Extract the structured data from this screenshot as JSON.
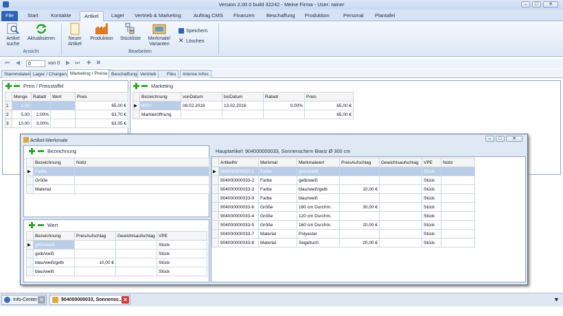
{
  "window": {
    "title": "Version 2.00.0  build 32242 - Meine Firma - User: rainer"
  },
  "ribbon_tabs": [
    "File",
    "Start",
    "Kontakte",
    "Artikel",
    "Lager",
    "Vertrieb & Marketing",
    "Auftrag CMS",
    "Finanzen",
    "Beschaffung",
    "Produktion",
    "Personal",
    "Plantafel"
  ],
  "ribbon": {
    "artikel_suche": "Artikel suche",
    "aktualisieren": "Aktualisieren",
    "neuer_artikel": "Neuer Artikel",
    "produktion": "Produktion",
    "stueckliste": "Stückliste",
    "merkmale": "Merkmale/ Varianten",
    "speichern": "Speichern",
    "loeschen": "Löschen",
    "group_ansicht": "Ansicht",
    "group_bearbeiten": "Bearbeiten"
  },
  "navigator": {
    "position": "0",
    "of": "von 0"
  },
  "sub_tabs": [
    "Stammdaten",
    "Lager / Chargen",
    "Marketing / Preise",
    "Beschaffung",
    "Vertrieb",
    "Fibu",
    "Interne Infos"
  ],
  "preis": {
    "title": "Preis / Preisstaffel",
    "headers": [
      "Menge",
      "Rabatt",
      "Wert",
      "Preis"
    ],
    "rows": [
      {
        "idx": "1",
        "menge": "1,00",
        "rabatt": "",
        "wert": "",
        "preis": "65,00 €"
      },
      {
        "idx": "2",
        "menge": "5,00",
        "rabatt": "2,00%",
        "wert": "",
        "preis": "63,70 €"
      },
      {
        "idx": "3",
        "menge": "10,00",
        "rabatt": "3,00%",
        "wert": "",
        "preis": "63,05 €"
      }
    ]
  },
  "marketing": {
    "title": "Marketing",
    "headers": [
      "Bezeichnung",
      "vonDatum",
      "bisDatum",
      "Rabatt",
      "Preis"
    ],
    "rows": [
      {
        "bez": "WSV",
        "von": "08.02.2016",
        "bis": "13.02.2016",
        "rabatt": "0,00%",
        "preis": "65,00 €"
      },
      {
        "bez": "Markteröffnung",
        "von": "",
        "bis": "",
        "rabatt": "",
        "preis": "65,00 €"
      }
    ]
  },
  "modal": {
    "title": "Artikel-Merkmale",
    "bezeichnung_title": "Bezeichnung",
    "bez_headers": [
      "Bezeichnung",
      "Notiz"
    ],
    "bez_rows": [
      "Farbe",
      "Größe",
      "Material"
    ],
    "wert_title": "Wert",
    "wert_headers": [
      "Bezeichnung",
      "PreisAufschlag",
      "Gewichtsaufschlag",
      "VPE"
    ],
    "wert_rows": [
      {
        "bez": "grün/weiß",
        "preis": "",
        "vpe": "Stück"
      },
      {
        "bez": "gelb/weiß",
        "preis": "",
        "vpe": "Stück"
      },
      {
        "bez": "blau/weiß/gelb",
        "preis": "10,00 €",
        "vpe": "Stück"
      },
      {
        "bez": "blau/weiß",
        "preis": "",
        "vpe": "Stück"
      }
    ],
    "haupt_label": "Hauptartikel: 904000000033, Sonnenschirm Biariz  Ø 300 cm",
    "var_headers": [
      "ArtikelNr",
      "Merkmal",
      "Merkmalwert",
      "PreisAufschlag",
      "Gewichtsaufschlag",
      "VPE",
      "Notiz"
    ],
    "var_rows": [
      {
        "nr": "904000000033-1",
        "m": "Farbe",
        "w": "grün/weiß",
        "p": "",
        "vpe": "Stück"
      },
      {
        "nr": "904000000033-2",
        "m": "Farbe",
        "w": "gelb/weiß",
        "p": "",
        "vpe": "Stück"
      },
      {
        "nr": "904000000033-3",
        "m": "Farbe",
        "w": "blau/weiß/gelb",
        "p": "10,00 €",
        "vpe": "Stück"
      },
      {
        "nr": "904000000033-9",
        "m": "Farbe",
        "w": "blau/weiß",
        "p": "",
        "vpe": "Stück"
      },
      {
        "nr": "904000000033-6",
        "m": "Größe",
        "w": "180 cm Durchm.",
        "p": "30,00 €",
        "vpe": "Stück"
      },
      {
        "nr": "904000000033-4",
        "m": "Größe",
        "w": "120 cm Durchm.",
        "p": "",
        "vpe": "Stück"
      },
      {
        "nr": "904000000033-5",
        "m": "Größe",
        "w": "160 cm Durchm.",
        "p": "20,00 €",
        "vpe": "Stück"
      },
      {
        "nr": "904000000033-7",
        "m": "Material",
        "w": "Polyester",
        "p": "",
        "vpe": "Stück"
      },
      {
        "nr": "904000000033-8",
        "m": "Material",
        "w": "Segeltuch",
        "p": "20,00 €",
        "vpe": "Stück"
      }
    ]
  },
  "bottom_tabs": [
    "Info-Center",
    "904000000033, Sonnensc..."
  ]
}
